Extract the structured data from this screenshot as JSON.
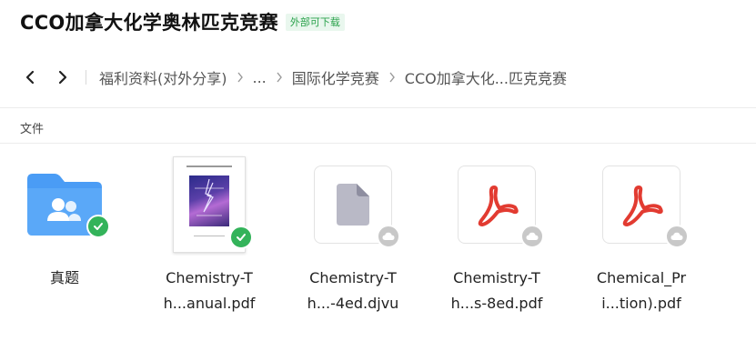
{
  "header": {
    "title": "CCO加拿大化学奥林匹克竞赛",
    "tag": "外部可下载"
  },
  "breadcrumb": {
    "items": [
      "福利资料(对外分享)",
      "...",
      "国际化学竞赛",
      "CCO加拿大化...匹克竞赛"
    ]
  },
  "section": {
    "label": "文件"
  },
  "files": [
    {
      "line1": "真题",
      "line2": "",
      "icon": "shared-folder-icon",
      "status": "synced"
    },
    {
      "line1": "Chemistry-T",
      "line2": "h...anual.pdf",
      "icon": "pdf-thumbnail",
      "status": "synced"
    },
    {
      "line1": "Chemistry-T",
      "line2": "h...-4ed.djvu",
      "icon": "generic-file-icon",
      "status": "cloud"
    },
    {
      "line1": "Chemistry-T",
      "line2": "h...s-8ed.pdf",
      "icon": "pdf-icon",
      "status": "cloud"
    },
    {
      "line1": "Chemical_Pr",
      "line2": "i...tion).pdf",
      "icon": "pdf-icon",
      "status": "cloud"
    }
  ],
  "colors": {
    "folder": "#4a9cf5",
    "pdf_red": "#e23b31",
    "success": "#33b35a",
    "cloud_badge": "#c8c8c8",
    "tag_text": "#2ba24c",
    "tag_bg": "#e9f7ee"
  }
}
